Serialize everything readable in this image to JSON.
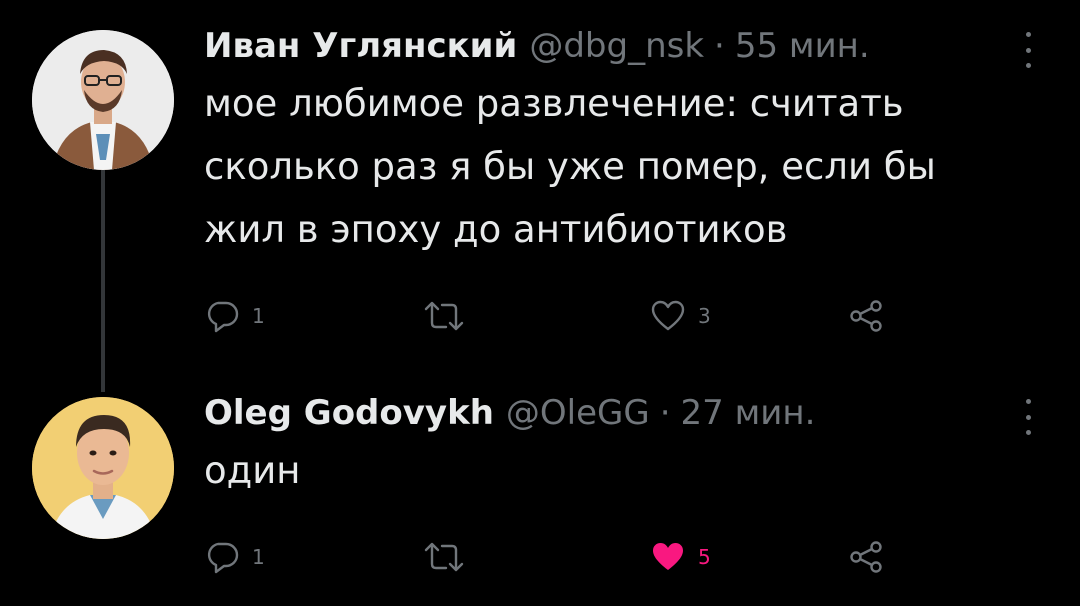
{
  "colors": {
    "background": "#000000",
    "text_primary": "#e7e9ea",
    "text_secondary": "#71767b",
    "thread_line": "#333639",
    "like_active": "#f91880"
  },
  "tweets": [
    {
      "name": "Иван Углянский",
      "handle": "@dbg_nsk",
      "separator": "·",
      "time": "55 мин.",
      "text": "мое любимое развлечение: считать\nсколько раз я бы уже помер, если бы\nжил в эпоху до антибиотиков",
      "avatar_icon": "user-avatar",
      "actions": {
        "reply": {
          "icon": "reply-icon",
          "count": "1"
        },
        "retweet": {
          "icon": "retweet-icon",
          "count": ""
        },
        "like": {
          "icon": "heart-outline-icon",
          "count": "3",
          "liked": false
        },
        "share": {
          "icon": "share-icon"
        }
      }
    },
    {
      "name": "Oleg Godovykh",
      "handle": "@OleGG",
      "separator": "·",
      "time": "27 мин.",
      "text": "один",
      "avatar_icon": "user-avatar",
      "actions": {
        "reply": {
          "icon": "reply-icon",
          "count": "1"
        },
        "retweet": {
          "icon": "retweet-icon",
          "count": ""
        },
        "like": {
          "icon": "heart-filled-icon",
          "count": "5",
          "liked": true
        },
        "share": {
          "icon": "share-icon"
        }
      }
    }
  ]
}
